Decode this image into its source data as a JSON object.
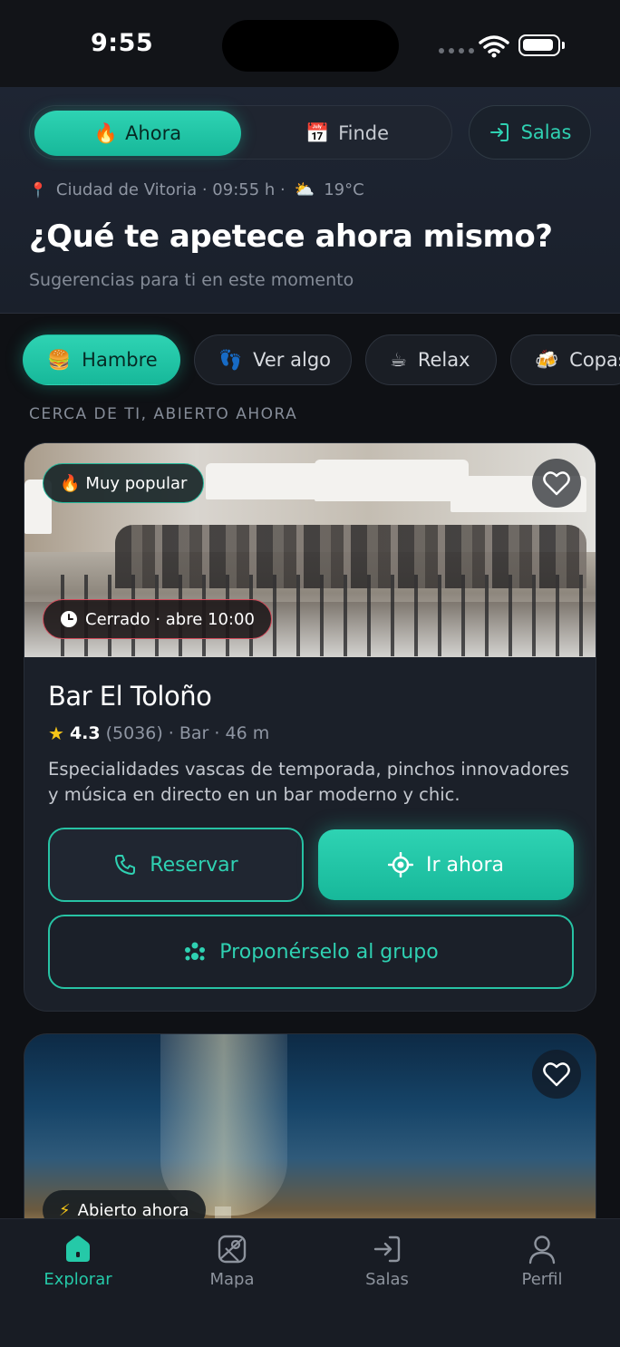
{
  "status_bar": {
    "time": "9:55"
  },
  "header": {
    "segments": [
      {
        "label": "Ahora",
        "icon": "fire-icon",
        "active": true
      },
      {
        "label": "Finde",
        "icon": "calendar-icon",
        "active": false
      }
    ],
    "salas_label": "Salas",
    "location": "Ciudad de Vitoria · 09:55 h ·",
    "temperature": "19°C",
    "title": "¿Qué te apetece ahora mismo?",
    "subtitle": "Sugerencias para ti en este momento"
  },
  "chips": [
    {
      "label": "Hambre",
      "icon": "burger-icon",
      "active": true
    },
    {
      "label": "Ver algo",
      "icon": "footprints-icon",
      "active": false
    },
    {
      "label": "Relax",
      "icon": "coffee-icon",
      "active": false
    },
    {
      "label": "Copas",
      "icon": "beer-icon",
      "active": false
    }
  ],
  "section_label": "CERCA DE TI, ABIERTO AHORA",
  "cards": [
    {
      "popular_badge": "Muy popular",
      "status_badge": "Cerrado · abre 10:00",
      "name": "Bar El Toloño",
      "rating": "4.3",
      "reviews": "(5036)",
      "meta": "· Bar · 46 m",
      "description": "Especialidades vascas de temporada, pinchos innovadores y música en directo en un bar moderno y chic.",
      "reserve_label": "Reservar",
      "go_label": "Ir ahora",
      "group_label": "Proponérselo al grupo"
    },
    {
      "status_badge": "Abierto ahora"
    }
  ],
  "tabbar": [
    {
      "label": "Explorar",
      "icon": "home-icon",
      "active": true
    },
    {
      "label": "Mapa",
      "icon": "map-icon",
      "active": false
    },
    {
      "label": "Salas",
      "icon": "enter-icon",
      "active": false
    },
    {
      "label": "Perfil",
      "icon": "user-icon",
      "active": false
    }
  ],
  "colors": {
    "accent": "#20c9a8",
    "background": "#0f1115",
    "danger": "#d24a5a"
  }
}
